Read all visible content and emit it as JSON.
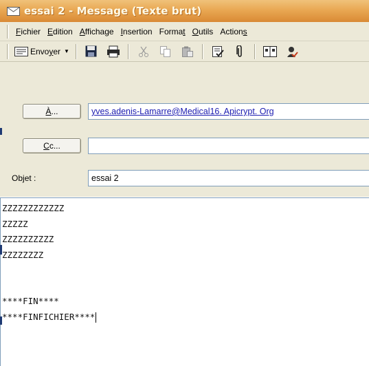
{
  "window": {
    "title": "essai 2 - Message (Texte brut)",
    "title_icon": "envelope-icon"
  },
  "menubar": {
    "items": [
      {
        "label_pre": "",
        "label_ul": "F",
        "label_post": "ichier"
      },
      {
        "label_pre": "",
        "label_ul": "E",
        "label_post": "dition"
      },
      {
        "label_pre": "",
        "label_ul": "A",
        "label_post": "ffichage"
      },
      {
        "label_pre": "",
        "label_ul": "I",
        "label_post": "nsertion"
      },
      {
        "label_pre": "Forma",
        "label_ul": "t",
        "label_post": ""
      },
      {
        "label_pre": "",
        "label_ul": "O",
        "label_post": "utils"
      },
      {
        "label_pre": "Action",
        "label_ul": "s",
        "label_post": ""
      }
    ]
  },
  "toolbar": {
    "send_pre": "Envo",
    "send_ul": "y",
    "send_post": "er",
    "icons": [
      "save-icon",
      "print-icon",
      "cut-icon",
      "copy-icon",
      "paste-icon",
      "check-names-icon",
      "attach-icon",
      "address-book-icon",
      "options-icon"
    ]
  },
  "form": {
    "to_button_ul": "À",
    "to_button_post": "...",
    "to_value": "yves.adenis-Lamarre@Medical16. Apicrypt. Org",
    "cc_button_ul": "C",
    "cc_button_post": "c...",
    "cc_value": "",
    "subject_label_pre": "Ob",
    "subject_label_ul": "j",
    "subject_label_post": "et :",
    "subject_value": "essai 2"
  },
  "body": {
    "lines": [
      "ZZZZZZZZZZZZ",
      "ZZZZZ",
      "ZZZZZZZZZZ",
      "ZZZZZZZZ",
      "",
      "",
      "****FIN****",
      "****FINFICHIER****"
    ]
  },
  "colors": {
    "title_gradient_top": "#f0c27a",
    "title_gradient_bottom": "#d98a35",
    "chrome": "#ece9d8",
    "link": "#1b1bb0"
  }
}
